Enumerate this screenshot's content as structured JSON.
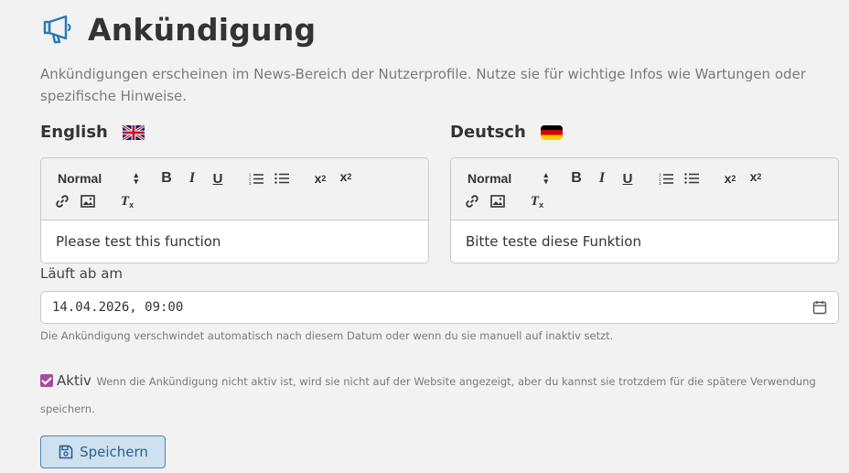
{
  "header": {
    "icon": "megaphone-icon",
    "title": "Ankündigung"
  },
  "description": "Ankündigungen erscheinen im News-Bereich der Nutzerprofile. Nutze sie für wichtige Infos wie Wartungen oder spezifische Hinweise.",
  "toolbar": {
    "format_label": "Normal",
    "bold": "B",
    "italic": "I",
    "underline": "U",
    "sub": "x",
    "sub_mark": "2",
    "sup": "x",
    "sup_mark": "2",
    "clean": "T",
    "clean_mark": "x"
  },
  "editors": [
    {
      "language": "English",
      "flag": "uk-flag-icon",
      "content": "Please test this function"
    },
    {
      "language": "Deutsch",
      "flag": "germany-flag-icon",
      "content": "Bitte teste diese Funktion"
    }
  ],
  "expiry": {
    "label": "Läuft ab am",
    "value": "14.04.2026, 09:00",
    "help": "Die Ankündigung verschwindet automatisch nach diesem Datum oder wenn du sie manuell auf inaktiv setzt."
  },
  "active": {
    "checked": true,
    "label": "Aktiv",
    "help": "Wenn die Ankündigung nicht aktiv ist, wird sie nicht auf der Website angezeigt, aber du kannst sie trotzdem für die spätere Verwendung speichern."
  },
  "save_button": {
    "label": "Speichern",
    "icon": "floppy-disk-icon"
  },
  "colors": {
    "accent": "#2a7ab8",
    "checkbox": "#a44c9e",
    "button_bg": "#cfe0ef",
    "button_border": "#4a86b8"
  }
}
